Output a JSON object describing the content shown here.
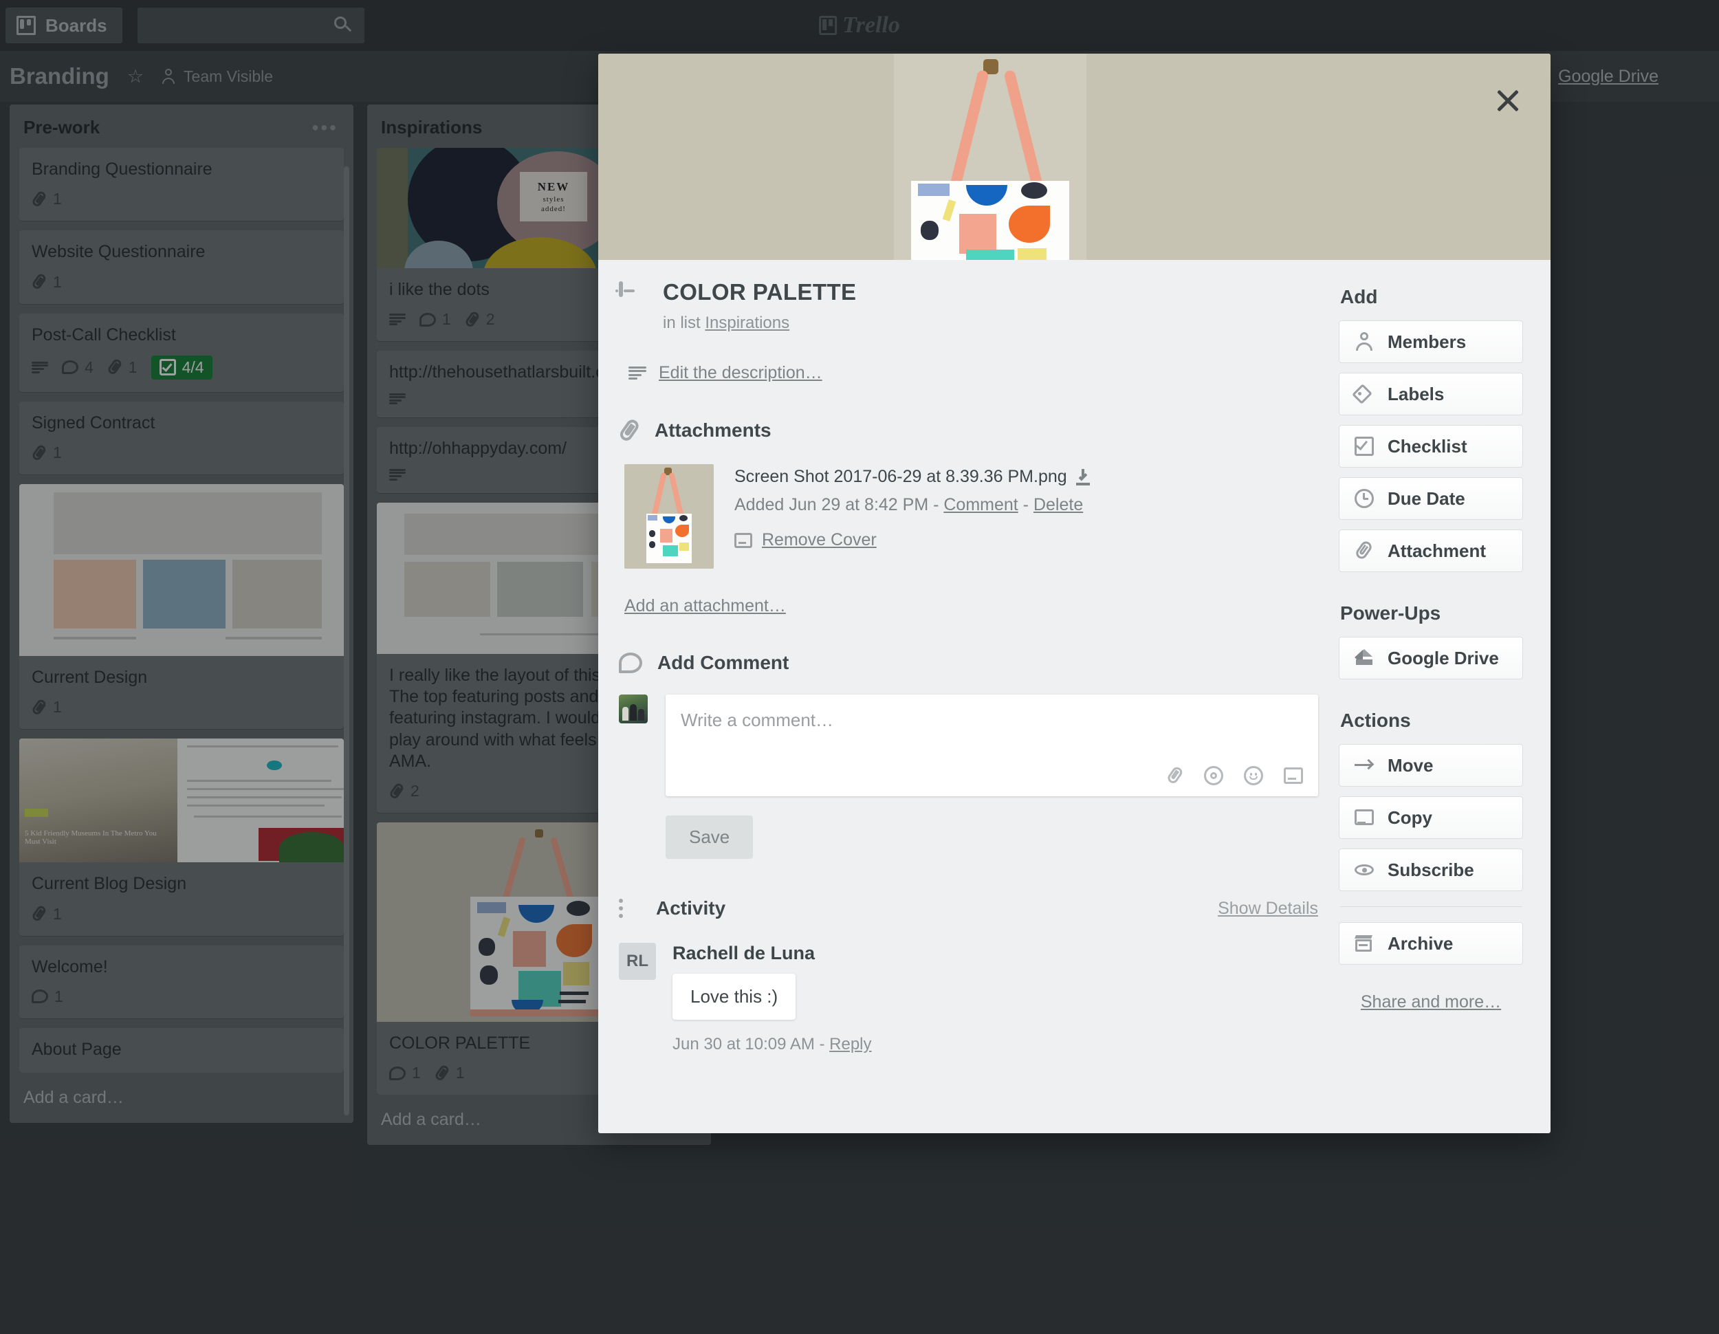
{
  "topnav": {
    "boards_label": "Boards",
    "search_placeholder": "",
    "brand": "Trello"
  },
  "board_header": {
    "title": "Branding",
    "star_glyph": "☆",
    "visibility_label": "Team Visible",
    "gdrive_label": "Google Drive"
  },
  "lists": [
    {
      "title": "Pre-work",
      "menu_glyph": "•••",
      "add_card_label": "Add a card…",
      "cards": [
        {
          "title": "Branding Questionnaire",
          "cover": null,
          "badges": [
            {
              "type": "attachment",
              "value": "1"
            }
          ]
        },
        {
          "title": "Website Questionnaire",
          "cover": null,
          "badges": [
            {
              "type": "attachment",
              "value": "1"
            }
          ]
        },
        {
          "title": "Post-Call Checklist",
          "cover": null,
          "badges": [
            {
              "type": "description",
              "value": ""
            },
            {
              "type": "comment",
              "value": "4"
            },
            {
              "type": "attachment",
              "value": "1"
            },
            {
              "type": "checklist",
              "value": "4/4",
              "color": "#0f7a2e"
            }
          ]
        },
        {
          "title": "Signed Contract",
          "cover": null,
          "badges": [
            {
              "type": "attachment",
              "value": "1"
            }
          ]
        },
        {
          "title": "Current Design",
          "cover": "website",
          "badges": [
            {
              "type": "attachment",
              "value": "1"
            }
          ]
        },
        {
          "title": "Current Blog Design",
          "cover": "blog",
          "badges": [
            {
              "type": "attachment",
              "value": "1"
            }
          ]
        },
        {
          "title": "Welcome!",
          "cover": null,
          "badges": [
            {
              "type": "comment",
              "value": "1"
            }
          ]
        },
        {
          "title": "About Page",
          "cover": null,
          "badges": []
        }
      ]
    },
    {
      "title": "Inspirations",
      "menu_glyph": "",
      "add_card_label": "Add a card…",
      "cards": [
        {
          "title": "i like the dots",
          "cover": "dots",
          "badges": [
            {
              "type": "description",
              "value": ""
            },
            {
              "type": "comment",
              "value": "1"
            },
            {
              "type": "attachment",
              "value": "2"
            }
          ]
        },
        {
          "title": "http://thehousethatlarsbuilt.com/",
          "cover": null,
          "badges": [
            {
              "type": "description",
              "value": ""
            }
          ]
        },
        {
          "title": "http://ohhappyday.com/",
          "cover": null,
          "badges": [
            {
              "type": "description",
              "value": ""
            }
          ]
        },
        {
          "title": "I really like the layout of this website. The top featuring posts and the bottom featuring instagram. I would love to play around with what feels right for AMA.",
          "cover": "website",
          "badges": [
            {
              "type": "attachment",
              "value": "2"
            }
          ]
        },
        {
          "title": "COLOR PALETTE",
          "cover": "bag",
          "badges": [
            {
              "type": "comment",
              "value": "1"
            },
            {
              "type": "attachment",
              "value": "1"
            }
          ]
        }
      ]
    }
  ],
  "modal": {
    "close_label": "×",
    "card_title": "COLOR PALETTE",
    "in_list_prefix": "in list",
    "in_list_name": "Inspirations",
    "edit_description_label": "Edit the description…",
    "attachments": {
      "section_title": "Attachments",
      "file_name": "Screen Shot 2017-06-29 at 8.39.36 PM.png",
      "added_text": "Added Jun 29 at 8:42 PM - ",
      "comment_link": "Comment",
      "separator": " - ",
      "delete_link": "Delete",
      "remove_cover_label": "Remove Cover",
      "add_attachment_label": "Add an attachment…"
    },
    "add_comment": {
      "section_title": "Add Comment",
      "placeholder": "Write a comment…",
      "save_label": "Save"
    },
    "activity": {
      "section_title": "Activity",
      "show_details_label": "Show Details",
      "items": [
        {
          "initials": "RL",
          "name": "Rachell de Luna",
          "text": "Love this :)",
          "time": "Jun 30 at 10:09 AM - ",
          "reply_label": "Reply"
        }
      ]
    },
    "sidebar": {
      "add_heading": "Add",
      "add_buttons": [
        {
          "label": "Members",
          "icon": "person-icon"
        },
        {
          "label": "Labels",
          "icon": "label-icon"
        },
        {
          "label": "Checklist",
          "icon": "checklist-icon"
        },
        {
          "label": "Due Date",
          "icon": "clock-icon"
        },
        {
          "label": "Attachment",
          "icon": "paperclip-icon"
        }
      ],
      "powerups_heading": "Power-Ups",
      "powerups_buttons": [
        {
          "label": "Google Drive",
          "icon": "google-drive-icon"
        }
      ],
      "actions_heading": "Actions",
      "actions_buttons": [
        {
          "label": "Move",
          "icon": "arrow-right-icon"
        },
        {
          "label": "Copy",
          "icon": "card-icon"
        },
        {
          "label": "Subscribe",
          "icon": "eye-icon"
        }
      ],
      "archive_button": {
        "label": "Archive",
        "icon": "archive-icon"
      },
      "share_label": "Share and more…"
    }
  },
  "colors": {
    "board_bg": "#32373a",
    "topnav_bg": "#2b3033",
    "list_bg": "#5d6366",
    "card_bg": "#6b7174",
    "modal_bg": "#eef0f1",
    "checklist_green": "#0f7a2e",
    "cover_bg": "#c6c3b2"
  }
}
